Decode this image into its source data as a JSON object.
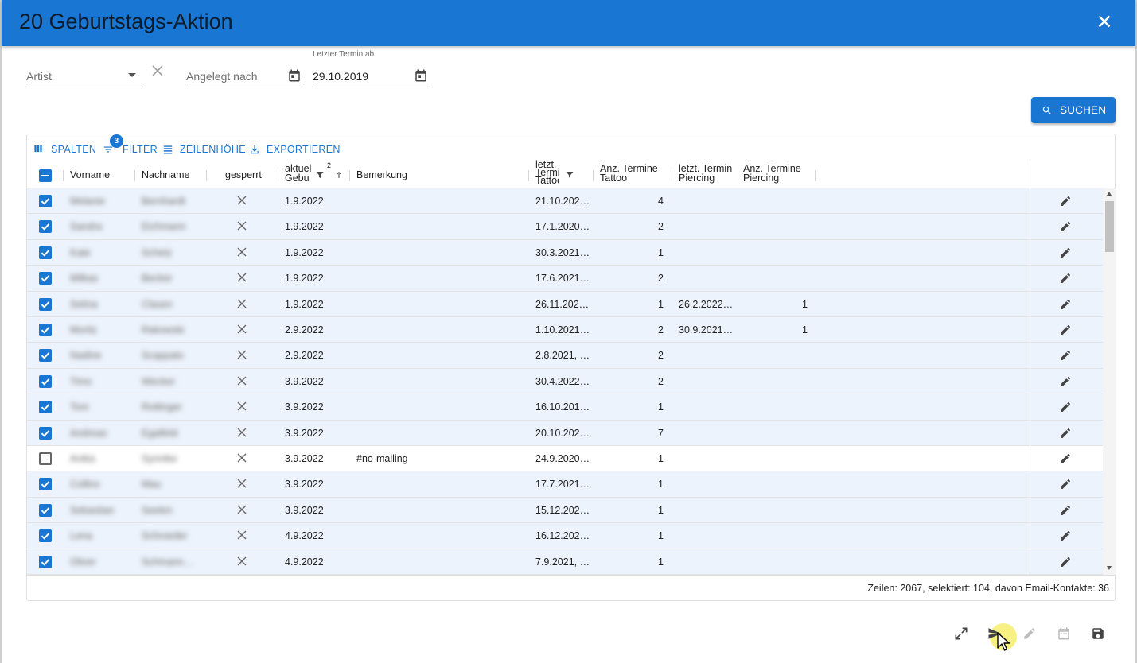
{
  "dialog": {
    "title": "20 Geburtstags-Aktion"
  },
  "filters": {
    "artist": {
      "label": "Artist",
      "value": ""
    },
    "angelegt": {
      "label": "Angelegt nach",
      "value": ""
    },
    "letzter_termin": {
      "label": "Letzter Termin ab",
      "value": "29.10.2019"
    }
  },
  "search_button": {
    "label": "SUCHEN"
  },
  "toolbar": {
    "spalten": "SPALTEN",
    "filter": "FILTER",
    "filter_badge": "3",
    "zeilenhoehe": "ZEILENHÖHE",
    "exportieren": "EXPORTIEREN"
  },
  "columns": {
    "vorname": "Vorname",
    "nachname": "Nachname",
    "gesperrt": "gesperrt",
    "aktuell_gebu_1": "aktuel",
    "aktuell_gebu_2": "Gebu",
    "sort_index": "2",
    "bemerkung": "Bemerkung",
    "letzt_tattoo_1": "letzt.",
    "letzt_tattoo_2": "Termi",
    "letzt_tattoo_3": "Tattoo",
    "anz_tattoo_1": "Anz. Termine",
    "anz_tattoo_2": "Tattoo",
    "letzt_piercing_1": "letzt. Termin",
    "letzt_piercing_2": "Piercing",
    "anz_piercing_1": "Anz. Termine",
    "anz_piercing_2": "Piercing"
  },
  "rows": [
    {
      "selected": true,
      "vorname": "Melanie",
      "nachname": "Bernhardt",
      "geb": "1.9.2022",
      "bemerkung": "",
      "lt_tattoo": "21.10.202…",
      "anz_tattoo": "4",
      "lt_piercing": "",
      "anz_piercing": ""
    },
    {
      "selected": true,
      "vorname": "Sandra",
      "nachname": "Eichmann",
      "geb": "1.9.2022",
      "bemerkung": "",
      "lt_tattoo": "17.1.2020…",
      "anz_tattoo": "2",
      "lt_piercing": "",
      "anz_piercing": ""
    },
    {
      "selected": true,
      "vorname": "Kate",
      "nachname": "Schetz",
      "geb": "1.9.2022",
      "bemerkung": "",
      "lt_tattoo": "30.3.2021…",
      "anz_tattoo": "1",
      "lt_piercing": "",
      "anz_piercing": ""
    },
    {
      "selected": true,
      "vorname": "Milkas",
      "nachname": "Becker",
      "geb": "1.9.2022",
      "bemerkung": "",
      "lt_tattoo": "17.6.2021…",
      "anz_tattoo": "2",
      "lt_piercing": "",
      "anz_piercing": ""
    },
    {
      "selected": true,
      "vorname": "Selina",
      "nachname": "Clasen",
      "geb": "1.9.2022",
      "bemerkung": "",
      "lt_tattoo": "26.11.202…",
      "anz_tattoo": "1",
      "lt_piercing": "26.2.2022…",
      "anz_piercing": "1"
    },
    {
      "selected": true,
      "vorname": "Moritz",
      "nachname": "Rakowski",
      "geb": "2.9.2022",
      "bemerkung": "",
      "lt_tattoo": "1.10.2021…",
      "anz_tattoo": "2",
      "lt_piercing": "30.9.2021…",
      "anz_piercing": "1"
    },
    {
      "selected": true,
      "vorname": "Nadine",
      "nachname": "Scappato",
      "geb": "2.9.2022",
      "bemerkung": "",
      "lt_tattoo": "2.8.2021, …",
      "anz_tattoo": "2",
      "lt_piercing": "",
      "anz_piercing": ""
    },
    {
      "selected": true,
      "vorname": "Timo",
      "nachname": "Wecker",
      "geb": "3.9.2022",
      "bemerkung": "",
      "lt_tattoo": "30.4.2022…",
      "anz_tattoo": "2",
      "lt_piercing": "",
      "anz_piercing": ""
    },
    {
      "selected": true,
      "vorname": "Toni",
      "nachname": "Rottinger",
      "geb": "3.9.2022",
      "bemerkung": "",
      "lt_tattoo": "16.10.201…",
      "anz_tattoo": "1",
      "lt_piercing": "",
      "anz_piercing": ""
    },
    {
      "selected": true,
      "vorname": "Andreas",
      "nachname": "Egalfeld",
      "geb": "3.9.2022",
      "bemerkung": "",
      "lt_tattoo": "20.10.202…",
      "anz_tattoo": "7",
      "lt_piercing": "",
      "anz_piercing": ""
    },
    {
      "selected": false,
      "vorname": "Anika",
      "nachname": "Synnike",
      "geb": "3.9.2022",
      "bemerkung": "#no-mailing",
      "lt_tattoo": "24.9.2020…",
      "anz_tattoo": "1",
      "lt_piercing": "",
      "anz_piercing": ""
    },
    {
      "selected": true,
      "vorname": "Collins",
      "nachname": "Mau",
      "geb": "3.9.2022",
      "bemerkung": "",
      "lt_tattoo": "17.7.2021…",
      "anz_tattoo": "1",
      "lt_piercing": "",
      "anz_piercing": ""
    },
    {
      "selected": true,
      "vorname": "Sebastian",
      "nachname": "Seelen",
      "geb": "3.9.2022",
      "bemerkung": "",
      "lt_tattoo": "15.12.202…",
      "anz_tattoo": "1",
      "lt_piercing": "",
      "anz_piercing": ""
    },
    {
      "selected": true,
      "vorname": "Lena",
      "nachname": "Schroeder",
      "geb": "4.9.2022",
      "bemerkung": "",
      "lt_tattoo": "16.12.202…",
      "anz_tattoo": "1",
      "lt_piercing": "",
      "anz_piercing": ""
    },
    {
      "selected": true,
      "vorname": "Oliver",
      "nachname": "Schmann…",
      "geb": "4.9.2022",
      "bemerkung": "",
      "lt_tattoo": "7.9.2021, …",
      "anz_tattoo": "1",
      "lt_piercing": "",
      "anz_piercing": ""
    }
  ],
  "footer": {
    "summary": "Zeilen: 2067, selektiert: 104, davon Email-Kontakte: 36"
  },
  "colors": {
    "primary": "#1976d2",
    "selected_row": "#edf3fc"
  },
  "icons": [
    "close-icon",
    "dropdown-arrow-icon",
    "clear-icon",
    "calendar-icon",
    "search-icon",
    "columns-icon",
    "filter-icon",
    "row-height-icon",
    "export-icon",
    "edit-icon",
    "expand-icon",
    "send-icon",
    "calendar-icon",
    "save-icon"
  ]
}
